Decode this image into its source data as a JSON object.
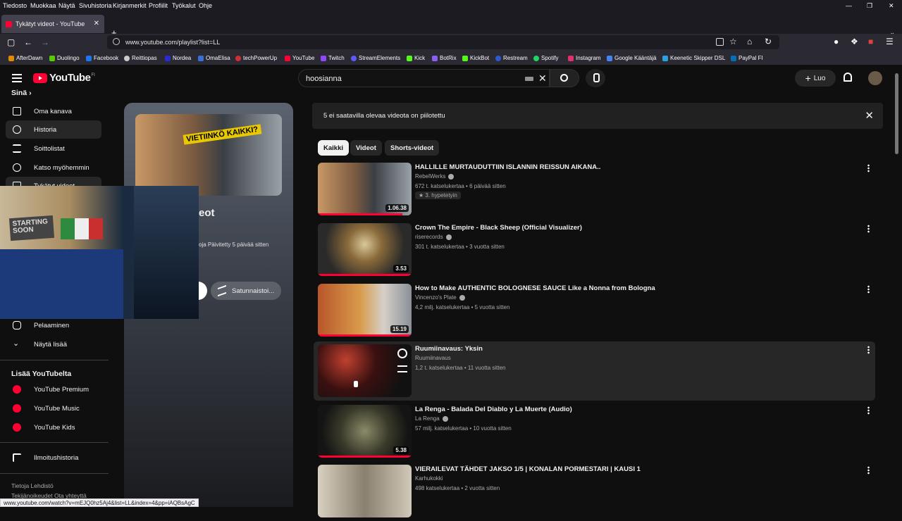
{
  "menubar": [
    "Tiedosto",
    "Muokkaa",
    "Näytä",
    "Sivuhistoria",
    "Kirjanmerkit",
    "Profiilit",
    "Työkalut",
    "Ohje"
  ],
  "tab": {
    "title": "Tykätyt videot - YouTube"
  },
  "address": {
    "url": "www.youtube.com/playlist?list=LL"
  },
  "bookmarks": [
    {
      "label": "AfterDawn",
      "color": "#e08a00"
    },
    {
      "label": "Duolingo",
      "color": "#58cc02"
    },
    {
      "label": "Facebook",
      "color": "#1877f2"
    },
    {
      "label": "Reittiopas",
      "color": "#cccccc"
    },
    {
      "label": "Nordea",
      "color": "#0000a0"
    },
    {
      "label": "OmaElisa",
      "color": "#3a6fd8"
    },
    {
      "label": "techPowerUp",
      "color": "#d03030"
    },
    {
      "label": "YouTube",
      "color": "#ff0033"
    },
    {
      "label": "Twitch",
      "color": "#9146ff"
    },
    {
      "label": "StreamElements",
      "color": "#5b5bff"
    },
    {
      "label": "Kick",
      "color": "#53fc18"
    },
    {
      "label": "BotRix",
      "color": "#8b5cf6"
    },
    {
      "label": "KickBot",
      "color": "#53fc18"
    },
    {
      "label": "Restream",
      "color": "#2a5bd7"
    },
    {
      "label": "Spotify",
      "color": "#1ed760"
    },
    {
      "label": "Instagram",
      "color": "#e1306c"
    },
    {
      "label": "Google Kääntäjä",
      "color": "#4285f4"
    },
    {
      "label": "Keenetic Skipper DSL",
      "color": "#2aa0e0"
    },
    {
      "label": "PayPal FI",
      "color": "#0070ba"
    }
  ],
  "youtube": {
    "logo_text": "YouTube",
    "country": "FI",
    "search_value": "hoosianna",
    "create_label": "Luo"
  },
  "sidebar": {
    "section_title": "Sinä",
    "items": [
      {
        "label": "Oma kanava",
        "icon": "person-box-icon"
      },
      {
        "label": "Historia",
        "icon": "history-icon"
      },
      {
        "label": "Soittolistat",
        "icon": "playlist-icon"
      },
      {
        "label": "Katso myöhemmin",
        "icon": "clock-icon"
      },
      {
        "label": "Tykätyt videot",
        "icon": "like-icon"
      },
      {
        "label": "Pelaaminen",
        "icon": "gamepad-icon"
      },
      {
        "label": "Näytä lisää",
        "icon": "chevron-down-icon"
      }
    ],
    "more_title": "Lisää YouTubelta",
    "more_items": [
      "YouTube Premium",
      "YouTube Music",
      "YouTube Kids"
    ],
    "report_history": "Ilmoitushistoria",
    "footer_line1": "Tietoja  Lehdistö",
    "footer_line2": "Tekijänoikeudet  Ota yhteyttä"
  },
  "playlist": {
    "thumb_text": "VIETIINKÖ KAIKKI?",
    "title_fragment": "eot",
    "meta_fragment": "oja  Päivitetty 5 päivää sitten",
    "shuffle_label": "Satunnaistoi..."
  },
  "webcam": {
    "sign_text": "STARTING SOON"
  },
  "banner": {
    "text": "5 ei saatavilla olevaa videota on piilotettu"
  },
  "chips": [
    "Kaikki",
    "Videot",
    "Shorts-videot"
  ],
  "videos": [
    {
      "title": "HALLILLE MURTAUDUTTIIN ISLANNIN REISSUN AIKANA..",
      "channel": "RebelWerks",
      "verified": true,
      "meta": "672 t. katselukertaa • 6 päivää sitten",
      "hype": "3. hypetetyin",
      "duration": "1.06.38",
      "progress": 0.9
    },
    {
      "title": "Crown The Empire - Black Sheep (Official Visualizer)",
      "channel": "riserecords",
      "verified": true,
      "meta": "301 t. katselukertaa • 3 vuotta sitten",
      "duration": "3.53",
      "progress": 1.0
    },
    {
      "title": "How to Make AUTHENTIC BOLOGNESE SAUCE Like a Nonna from Bologna",
      "channel": "Vincenzo's Plate",
      "verified": true,
      "meta": "4,2 milj. katselukertaa • 5 vuotta sitten",
      "duration": "15.19",
      "progress": 1.0
    },
    {
      "title": "Ruumiinavaus: Yksin",
      "channel": "Ruumiinavaus",
      "verified": false,
      "meta": "1,2 t. katselukertaa • 11 vuotta sitten",
      "duration": "",
      "progress": 0
    },
    {
      "title": "La Renga - Balada Del Diablo y La Muerte (Audio)",
      "channel": "La Renga",
      "verified": true,
      "meta": "57 milj. katselukertaa • 10 vuotta sitten",
      "duration": "5.38",
      "progress": 1.0
    },
    {
      "title": "VIERAILEVAT TÄHDET JAKSO 1/5 | KONALAN PORMESTARI | KAUSI 1",
      "channel": "Karhukokki",
      "verified": false,
      "meta": "498 katselukertaa • 2 vuotta sitten",
      "duration": "",
      "progress": 0
    }
  ],
  "status_url": "www.youtube.com/watch?v=mEJQ0hz5Aj4&list=LL&index=4&pp=iAQBsAgC"
}
